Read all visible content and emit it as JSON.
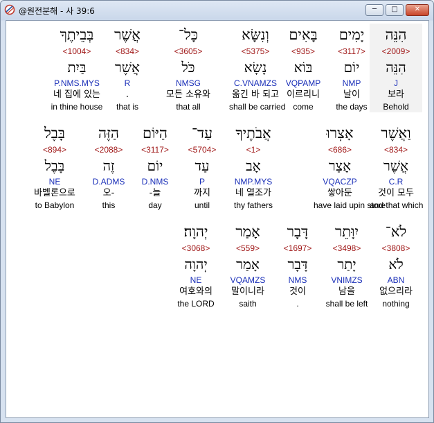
{
  "window": {
    "title": "@원전분해 - 사 39:6"
  },
  "rows": [
    [
      {
        "heb": "הִנֵּה",
        "num": "<2009>",
        "lemma": "הִנֵּה",
        "parse": "J",
        "kor": "보라",
        "eng": "Behold",
        "hl": true
      },
      {
        "heb": "יָמִים",
        "num": "<3117>",
        "lemma": "יוֹם",
        "parse": "NMP",
        "kor": "날이",
        "eng": "the days"
      },
      {
        "heb": "בָּאִים",
        "num": "<935>",
        "lemma": "בּוֹא",
        "parse": "VQPAMP",
        "kor": "이르리니",
        "eng": "come"
      },
      {
        "heb": "וְנִשָּׂא",
        "num": "<5375>",
        "lemma": "נָשָׂא",
        "parse": "C.VNAMZS",
        "kor": "옮긴 바 되고",
        "eng": "shall be carried"
      },
      {
        "heb": "כָּל־",
        "num": "<3605>",
        "lemma": "כֹּל",
        "parse": "NMSG",
        "kor": "모든 소유와",
        "eng": "that all"
      },
      {
        "heb": "אֲשֶׁר",
        "num": "<834>",
        "lemma": "אֲשֶׁר",
        "parse": "R",
        "kor": ".",
        "eng": "that is"
      },
      {
        "heb": "בְּבֵיתֶךָ",
        "num": "<1004>",
        "lemma": "בַּיִת",
        "parse": "P.NMS.MYS",
        "kor": "네 집에 있는",
        "eng": "in thine house"
      }
    ],
    [
      {
        "heb": "וַאֲשֶׁר",
        "num": "<834>",
        "lemma": "אֲשֶׁר",
        "parse": "C.R",
        "kor": "것이 모두",
        "eng": "and that which"
      },
      {
        "heb": "אָצְרוּ",
        "num": "<686>",
        "lemma": "אָצַר",
        "parse": "VQACZP",
        "kor": "쌓아둔",
        "eng": "have laid upin store"
      },
      {
        "heb": "אֲבֹתֶיךָ",
        "num": "<1>",
        "lemma": "אָב",
        "parse": "NMP.MYS",
        "kor": "네 열조가",
        "eng": "thy fathers"
      },
      {
        "heb": "עַד־",
        "num": "<5704>",
        "lemma": "עַד",
        "parse": "P",
        "kor": "까지",
        "eng": "until"
      },
      {
        "heb": "הַיּוֹם",
        "num": "<3117>",
        "lemma": "יוֹם",
        "parse": "D.NMS",
        "kor": "-늘",
        "eng": "day"
      },
      {
        "heb": "הַזֶּה",
        "num": "<2088>",
        "lemma": "זֶה",
        "parse": "D.ADMS",
        "kor": "오-",
        "eng": "this"
      },
      {
        "heb": "בָּבֶל",
        "num": "<894>",
        "lemma": "בָּבֶל",
        "parse": "NE",
        "kor": "바벨론으로",
        "eng": "to Babylon"
      }
    ],
    [
      {
        "heb": "לֹא־",
        "num": "<3808>",
        "lemma": "לֹא",
        "parse": "ABN",
        "kor": "없으리라",
        "eng": "nothing"
      },
      {
        "heb": "יִוָּתֵר",
        "num": "<3498>",
        "lemma": "יָתַר",
        "parse": "VNIMZS",
        "kor": "남을",
        "eng": "shall be left"
      },
      {
        "heb": "דָּבָר",
        "num": "<1697>",
        "lemma": "דָּבָר",
        "parse": "NMS",
        "kor": "것이",
        "eng": "."
      },
      {
        "heb": "אָמַר",
        "num": "<559>",
        "lemma": "אָמַר",
        "parse": "VQAMZS",
        "kor": "말이니라",
        "eng": "saith"
      },
      {
        "heb": "יְהוָה׃",
        "num": "<3068>",
        "lemma": "יְהוָה",
        "parse": "NE",
        "kor": "여호와의",
        "eng": "the LORD"
      }
    ]
  ]
}
